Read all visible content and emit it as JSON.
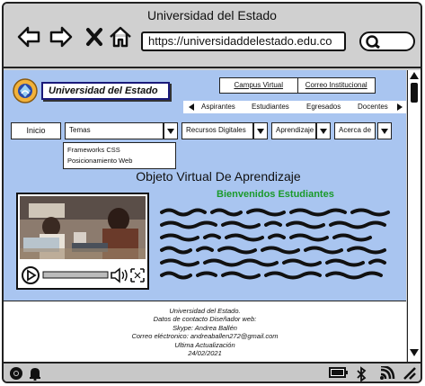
{
  "window": {
    "title": "Universidad del Estado"
  },
  "browser": {
    "url": "https://universidaddelestado.edu.co"
  },
  "site": {
    "brand": "Universidad del Estado",
    "top_links": [
      "Campus Virtual",
      "Correo Institucional"
    ],
    "audience": [
      "Aspirantes",
      "Estudiantes",
      "Egresados",
      "Docentes"
    ],
    "menu": {
      "inicio": "Inicio",
      "temas": "Temas",
      "recursos": "Recursos Digitales",
      "aprendizaje": "Aprendizaje",
      "acerca": "Acerca de"
    },
    "temas_options": [
      "Frameworks CSS",
      "Posicionamiento Web"
    ]
  },
  "content": {
    "title": "Objeto Virtual De Aprendizaje",
    "welcome": "Bienvenidos Estudiantes"
  },
  "footer": {
    "lines": [
      "Universidad del Estado.",
      "Datos de contacto Diseñador web:",
      "Skype: Andrea Ballén",
      "Correo eléctronico: andreaballen272@gmail.com",
      "Ultima Actualización",
      "24/02/2021"
    ]
  },
  "icons": [
    "back-arrow-icon",
    "forward-arrow-icon",
    "close-icon",
    "home-icon",
    "search-icon",
    "play-icon",
    "volume-icon",
    "fullscreen-icon",
    "chrome-icon",
    "bell-icon",
    "battery-icon",
    "bluetooth-icon",
    "wifi-icon",
    "resize-icon"
  ],
  "colors": {
    "page_bg": "#a9c5f0",
    "welcome_green": "#1a9a2a",
    "brand_border": "#1a1a7a"
  }
}
